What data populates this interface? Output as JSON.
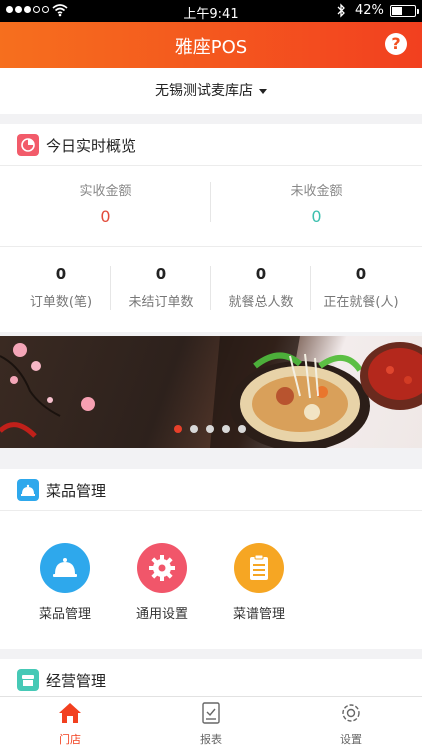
{
  "status_bar": {
    "time": "上午9:41",
    "battery": "42%"
  },
  "header": {
    "title": "雅座POS",
    "help": "?"
  },
  "store": {
    "name": "无锡测试麦库店"
  },
  "overview": {
    "title": "今日实时概览",
    "received": {
      "label": "实收金额",
      "value": "0"
    },
    "unreceived": {
      "label": "未收金额",
      "value": "0"
    },
    "stats": [
      {
        "label": "订单数(笔)",
        "value": "0"
      },
      {
        "label": "未结订单数",
        "value": "0"
      },
      {
        "label": "就餐总人数",
        "value": "0"
      },
      {
        "label": "正在就餐(人)",
        "value": "0"
      }
    ]
  },
  "banner": {
    "page_count": 5,
    "active_index": 0
  },
  "menu_section": {
    "title": "菜品管理",
    "items": [
      {
        "label": "菜品管理",
        "icon": "cloche-icon",
        "color": "#2ea8ec"
      },
      {
        "label": "通用设置",
        "icon": "gear-icon",
        "color": "#f1566a"
      },
      {
        "label": "菜谱管理",
        "icon": "clipboard-icon",
        "color": "#f6a623"
      }
    ]
  },
  "operations_section": {
    "title": "经营管理"
  },
  "tabbar": {
    "items": [
      {
        "label": "门店",
        "icon": "store-icon",
        "active": true
      },
      {
        "label": "报表",
        "icon": "report-icon",
        "active": false
      },
      {
        "label": "设置",
        "icon": "settings-icon",
        "active": false
      }
    ]
  },
  "colors": {
    "accent": "#f2401f",
    "red_value": "#e24b3b",
    "teal_value": "#3cbfae"
  }
}
